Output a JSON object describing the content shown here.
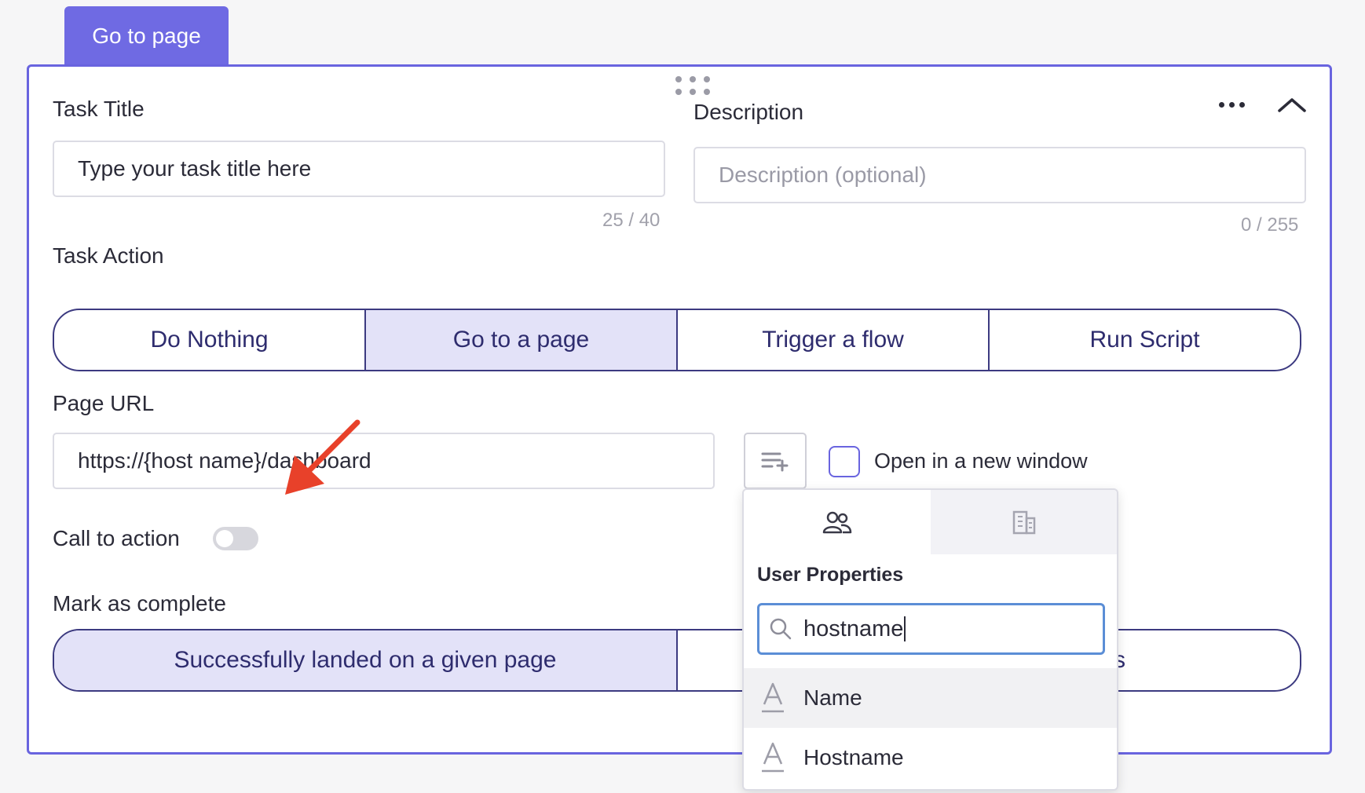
{
  "top_tab": {
    "label": "Go to page"
  },
  "task_title": {
    "label": "Task Title",
    "value": "Type your task title here",
    "counter": "25 / 40"
  },
  "description": {
    "label": "Description",
    "placeholder": "Description (optional)",
    "counter": "0 / 255"
  },
  "task_action": {
    "label": "Task Action",
    "options": [
      "Do Nothing",
      "Go to a page",
      "Trigger a flow",
      "Run Script"
    ],
    "selected": "Go to a page"
  },
  "page_url": {
    "label": "Page URL",
    "value": "https://{host name}/dashboard",
    "open_new_window_label": "Open in a new window",
    "open_new_window_checked": false
  },
  "call_to_action": {
    "label": "Call to action",
    "enabled": false
  },
  "mark_as_complete": {
    "label": "Mark as complete",
    "options": [
      "Successfully landed on a given page",
      "s"
    ],
    "selected": "Successfully landed on a given page"
  },
  "property_picker": {
    "tabs": [
      {
        "icon": "users-icon",
        "active": true
      },
      {
        "icon": "building-icon",
        "active": false
      }
    ],
    "section_title": "User Properties",
    "search_value": "hostname",
    "items": [
      {
        "icon": "text-type-icon",
        "label": "Name"
      },
      {
        "icon": "text-type-icon",
        "label": "Hostname"
      }
    ]
  },
  "colors": {
    "accent": "#6964df",
    "tab_bg": "#6f6ae3",
    "segment_active_bg": "#e3e2f8",
    "segment_text": "#2e2c6e",
    "annotation_arrow": "#e8412a",
    "search_focus": "#5b8ed6"
  }
}
